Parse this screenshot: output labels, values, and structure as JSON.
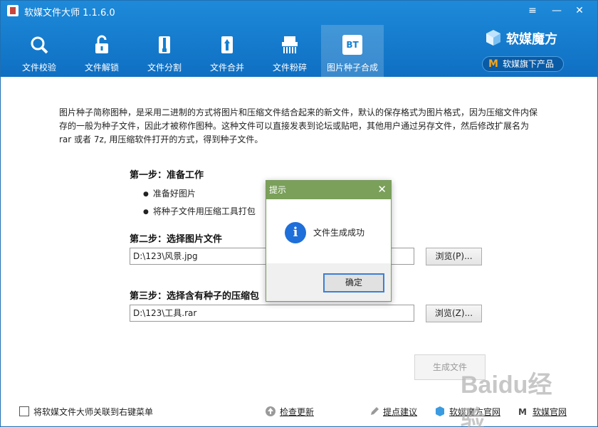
{
  "app": {
    "title": "软媒文件大师 1.1.6.0"
  },
  "window_controls": {
    "menu": "≡",
    "minimize": "—",
    "close": "✕"
  },
  "tabs": [
    {
      "label": "文件校验",
      "icon": "magnifier-icon"
    },
    {
      "label": "文件解锁",
      "icon": "unlock-icon"
    },
    {
      "label": "文件分割",
      "icon": "zipper-split-icon"
    },
    {
      "label": "文件合并",
      "icon": "zipper-merge-icon"
    },
    {
      "label": "文件粉碎",
      "icon": "shredder-icon"
    },
    {
      "label": "图片种子合成",
      "icon": "bt-icon",
      "icon_text": "BT",
      "active": true
    }
  ],
  "brand": {
    "name": "软媒魔方",
    "products_button": "软媒旗下产品",
    "products_icon_text": "M"
  },
  "description": "图片种子简称图种，是采用二进制的方式将图片和压缩文件结合起来的新文件，默认的保存格式为图片格式，因为压缩文件内保存的一般为种子文件，因此才被称作图种。这种文件可以直接发表到论坛或贴吧，其他用户通过另存文件，然后修改扩展名为 rar 或者 7z, 用压缩软件打开的方式，得到种子文件。",
  "step1": {
    "title": "第一步：准备工作",
    "bullets": [
      "准备好图片",
      "将种子文件用压缩工具打包"
    ]
  },
  "step2": {
    "title": "第二步：选择图片文件",
    "value": "D:\\123\\风景.jpg",
    "browse": "浏览(P)..."
  },
  "step3": {
    "title": "第三步：选择含有种子的压缩包",
    "value": "D:\\123\\工具.rar",
    "browse": "浏览(Z)..."
  },
  "generate_button": "生成文件",
  "footer": {
    "checkbox_label": "将软媒文件大师关联到右键菜单",
    "check_update": "检查更新",
    "suggestion": "提点建议",
    "mofang_site": "软媒魔方官网",
    "ruanmei_site": "软媒官网"
  },
  "dialog": {
    "title": "提示",
    "message": "文件生成成功",
    "ok": "确定",
    "icon_text": "i",
    "close": "✕"
  },
  "watermark": "Baidu经验",
  "colors": {
    "header": "#1280d1",
    "dialog_title": "#7aa05a",
    "info_icon": "#1e6fd9"
  }
}
